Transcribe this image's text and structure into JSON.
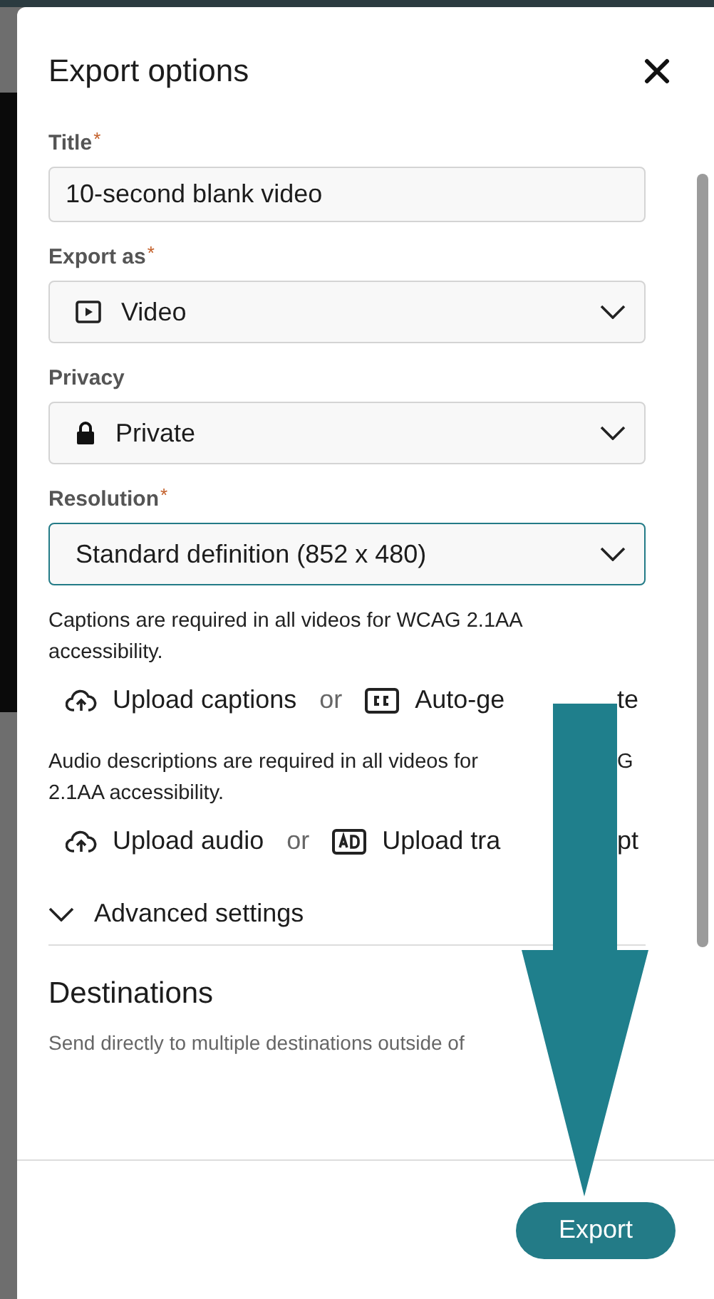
{
  "dialog": {
    "title": "Export options"
  },
  "required_mark": "*",
  "fields": [
    {
      "kind": "text",
      "label": "Title",
      "required": true,
      "value": "10-second blank video",
      "focused": false
    },
    {
      "kind": "select",
      "label": "Export as",
      "required": true,
      "value": "Video",
      "focused": false
    },
    {
      "kind": "select",
      "label": "Privacy",
      "required": false,
      "value": "Private",
      "focused": false
    },
    {
      "kind": "select",
      "label": "Resolution",
      "required": true,
      "value": "Standard definition (852 x 480)",
      "focused": true
    }
  ],
  "notes": [
    {
      "lines": [
        {
          "left": "Captions are required in all videos for WCAG 2.1AA"
        },
        {
          "left": "accessibility."
        }
      ],
      "separator": "or",
      "actions": [
        {
          "label": "Upload captions"
        },
        {
          "label": "Auto-ge",
          "after_arrow": "te"
        }
      ]
    },
    {
      "lines": [
        {
          "left": "Audio descriptions are required in all videos for",
          "after_arrow": "G"
        },
        {
          "left": "2.1AA accessibility."
        }
      ],
      "separator": "or",
      "actions": [
        {
          "label": "Upload audio"
        },
        {
          "label": "Upload tra",
          "after_arrow": "pt"
        }
      ]
    }
  ],
  "advanced": {
    "label": "Advanced settings",
    "expanded": false
  },
  "destinations": {
    "heading": "Destinations",
    "text": "Send directly to multiple destinations outside of"
  },
  "footer": {
    "button": "Export"
  }
}
